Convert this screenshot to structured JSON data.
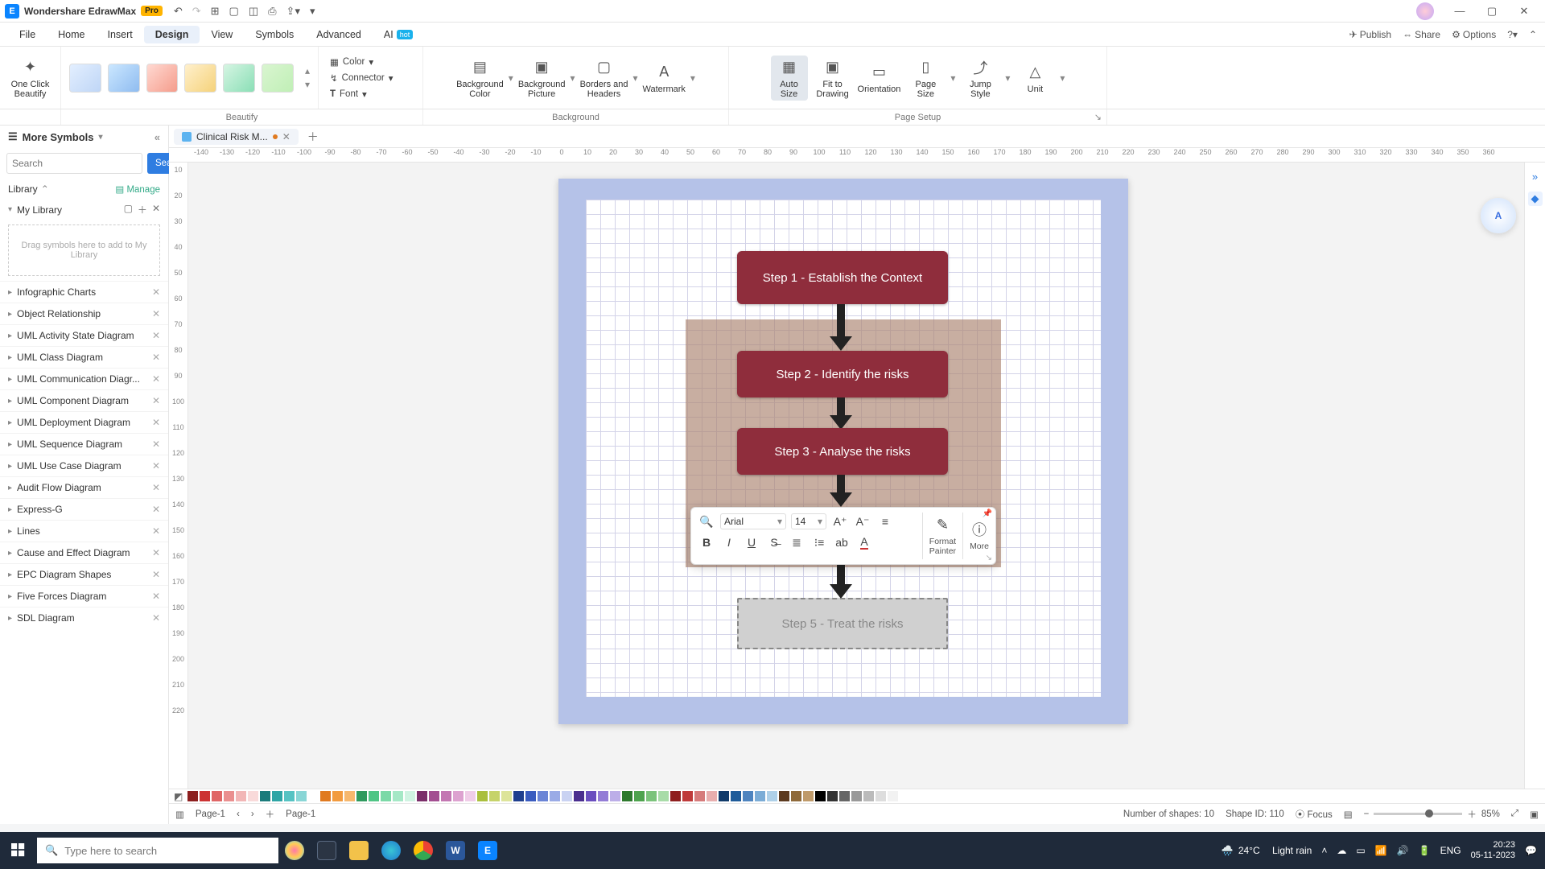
{
  "app": {
    "name": "Wondershare EdrawMax",
    "badge": "Pro"
  },
  "menus": {
    "file": "File",
    "home": "Home",
    "insert": "Insert",
    "design": "Design",
    "view": "View",
    "symbols": "Symbols",
    "advanced": "Advanced",
    "ai": "AI",
    "hot": "hot"
  },
  "topright": {
    "publish": "Publish",
    "share": "Share",
    "options": "Options"
  },
  "ribbon": {
    "oneclick": "One Click\nBeautify",
    "color": "Color",
    "connector": "Connector",
    "font": "Font",
    "bgcolor": "Background\nColor",
    "bgpic": "Background\nPicture",
    "borders": "Borders and\nHeaders",
    "watermark": "Watermark",
    "autosize": "Auto\nSize",
    "fit": "Fit to\nDrawing",
    "orientation": "Orientation",
    "pagesize": "Page\nSize",
    "jump": "Jump\nStyle",
    "unit": "Unit",
    "labels": {
      "beautify": "Beautify",
      "background": "Background",
      "pagesetup": "Page Setup"
    }
  },
  "sidebar": {
    "title": "More Symbols",
    "search_placeholder": "Search",
    "search_btn": "Search",
    "library": "Library",
    "manage": "Manage",
    "mylib": "My Library",
    "dropzone": "Drag symbols here to add to My Library",
    "cats": [
      "Infographic Charts",
      "Object Relationship",
      "UML Activity State Diagram",
      "UML Class Diagram",
      "UML Communication Diagr...",
      "UML Component Diagram",
      "UML Deployment Diagram",
      "UML Sequence Diagram",
      "UML Use Case Diagram",
      "Audit Flow Diagram",
      "Express-G",
      "Lines",
      "Cause and Effect Diagram",
      "EPC Diagram Shapes",
      "Five Forces Diagram",
      "SDL Diagram"
    ]
  },
  "doc": {
    "tabname": "Clinical Risk M...",
    "page_tab": "Page-1",
    "page_drop": "Page-1"
  },
  "ruler_h": [
    "-140",
    "-130",
    "-120",
    "-110",
    "-100",
    "-90",
    "-80",
    "-70",
    "-60",
    "-50",
    "-40",
    "-30",
    "-20",
    "-10",
    "0",
    "10",
    "20",
    "30",
    "40",
    "50",
    "60",
    "70",
    "80",
    "90",
    "100",
    "110",
    "120",
    "130",
    "140",
    "150",
    "160",
    "170",
    "180",
    "190",
    "200",
    "210",
    "220",
    "230",
    "240",
    "250",
    "260",
    "270",
    "280",
    "290",
    "300",
    "310",
    "320",
    "330",
    "340",
    "350",
    "360"
  ],
  "ruler_v": [
    "10",
    "20",
    "30",
    "40",
    "50",
    "60",
    "70",
    "80",
    "90",
    "100",
    "110",
    "120",
    "130",
    "140",
    "150",
    "160",
    "170",
    "180",
    "190",
    "200",
    "210",
    "220"
  ],
  "steps": {
    "s1": "Step 1 - Establish the Context",
    "s2": "Step 2 - Identify  the risks",
    "s3": "Step 3 - Analyse the risks",
    "s5": "Step 5 - Treat the risks"
  },
  "floatbar": {
    "font": "Arial",
    "size": "14",
    "format_painter": "Format\nPainter",
    "more": "More"
  },
  "status": {
    "shapes": "Number of shapes: 10",
    "shapeid": "Shape ID: 110",
    "focus": "Focus",
    "zoom": "85%"
  },
  "taskbar": {
    "search_ph": "Type here to search",
    "temp": "24°C",
    "weather": "Light rain",
    "lang": "ENG",
    "time": "20:23",
    "date": "05-11-2023"
  },
  "swatches": [
    "#8d1f1f",
    "#c33",
    "#e06666",
    "#ea8f8f",
    "#f2b6b6",
    "#f9dada",
    "#1b7b7b",
    "#2ea5a5",
    "#56c3c3",
    "#89d6d6",
    "#ffffff",
    "#e07a20",
    "#f29b3f",
    "#f6b86e",
    "#2e9a5e",
    "#4fc585",
    "#7bd9a7",
    "#a5e8c6",
    "#d0f3e2",
    "#7b2e6a",
    "#a34e91",
    "#c377b2",
    "#dda2d0",
    "#f0cde8",
    "#aabf3c",
    "#c6d36a",
    "#dde49a",
    "#1f3f8f",
    "#3a5cc0",
    "#6a84d6",
    "#9aabe6",
    "#c9d2f2",
    "#4a2e8f",
    "#6a4ebf",
    "#937cd6",
    "#bcaee8",
    "#2e7a2e",
    "#4ea34e",
    "#7bc37b",
    "#a8dca8",
    "#8f1f1f",
    "#bf3a3a",
    "#d67b7b",
    "#e8aeae",
    "#103a6a",
    "#1f5c9a",
    "#4e84bf",
    "#7bacd6",
    "#aed0e8",
    "#5c3a1f",
    "#8f6a3a",
    "#bf9a6a",
    "#000000",
    "#333333",
    "#666666",
    "#999999",
    "#bbbbbb",
    "#dddddd",
    "#f2f2f2",
    "#ffffff"
  ]
}
